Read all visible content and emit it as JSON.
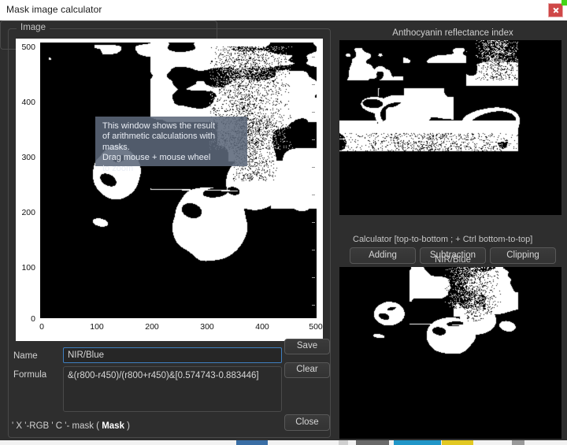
{
  "window": {
    "title": "Mask image calculator",
    "close_label": "x",
    "close_icon": "close-icon",
    "close_color": "#cf4747"
  },
  "image_panel": {
    "group_title": "Image",
    "tooltip": "This window shows the result\nof arithmetic calculations with masks.\nDrag mouse + mouse wheel\nto zoom",
    "axes": {
      "y_ticks": [
        "500",
        "400",
        "300",
        "200",
        "100",
        "0"
      ],
      "x_ticks": [
        "0",
        "100",
        "200",
        "300",
        "400",
        "500"
      ],
      "x_range": [
        0,
        500
      ],
      "y_range": [
        0,
        500
      ]
    }
  },
  "form": {
    "name_label": "Name",
    "name_value": "NIR/Blue",
    "name_placeholder": "",
    "formula_label": "Formula",
    "formula_value": "&(r800-r450)/(r800+r450)&[0.574743-0.883446]",
    "formula_placeholder": "",
    "save_label": "Save",
    "clear_label": "Clear",
    "close_label": "Close"
  },
  "status": {
    "prefix": "' X '-RGB ' C '- mask ( ",
    "emphasis": "Mask",
    "suffix": " )"
  },
  "right_panel": {
    "top_title": "Anthocyanin reflectance index",
    "bottom_title": "NIR/Blue",
    "calculator_title": "Calculator [top-to-bottom ; + Ctrl bottom-to-top]",
    "buttons": [
      {
        "label": "Adding"
      },
      {
        "label": "Subtraction"
      },
      {
        "label": "Clipping"
      }
    ]
  },
  "theme": {
    "bg": "#2e2e2e",
    "titlebar_bg": "#ffffff",
    "accent_focus": "#3f7fbf",
    "border": "#4a4a4a",
    "text": "#d2d2d2"
  },
  "chart_data": {
    "type": "heatmap",
    "title": "Image",
    "xlabel": "",
    "ylabel": "",
    "xlim": [
      0,
      500
    ],
    "ylim": [
      0,
      500
    ],
    "xticks": [
      0,
      100,
      200,
      300,
      400,
      500
    ],
    "yticks": [
      0,
      100,
      200,
      300,
      400,
      500
    ],
    "grid": false,
    "legend": null,
    "note": "Binary (black/white) mask raster of tomatoes on a bench, 500x500 pixel extent"
  }
}
